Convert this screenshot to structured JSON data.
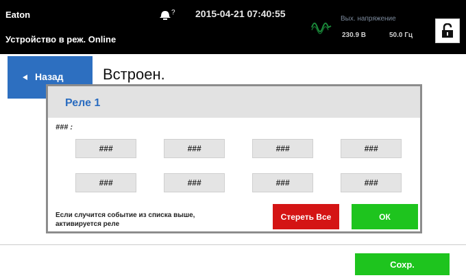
{
  "header": {
    "brand": "Eaton",
    "mode": "Устройство в реж. Online",
    "datetime": "2015-04-21 07:40:55",
    "output_label": "Вых. напряжение",
    "output_voltage": "230.9 В",
    "output_frequency": "50.0 Гц",
    "icons": [
      "alarm-bell-icon",
      "sine-wave-icon",
      "unlocked-padlock-icon"
    ]
  },
  "nav": {
    "back_label": "Назад",
    "page_title": "Встроен."
  },
  "dialog": {
    "title": "Реле 1",
    "field_label": "### :",
    "relay_buttons": [
      "###",
      "###",
      "###",
      "###",
      "###",
      "###",
      "###",
      "###"
    ],
    "note_line1": "Если случится событие из списка выше,",
    "note_line2": "активируется реле",
    "clear_label": "Стереть Все",
    "ok_label": "ОК"
  },
  "footer": {
    "save_label": "Сохр."
  },
  "colors": {
    "header_bg": "#000000",
    "accent_blue": "#2d6fc0",
    "action_green": "#1ec41e",
    "action_red": "#d41414"
  }
}
